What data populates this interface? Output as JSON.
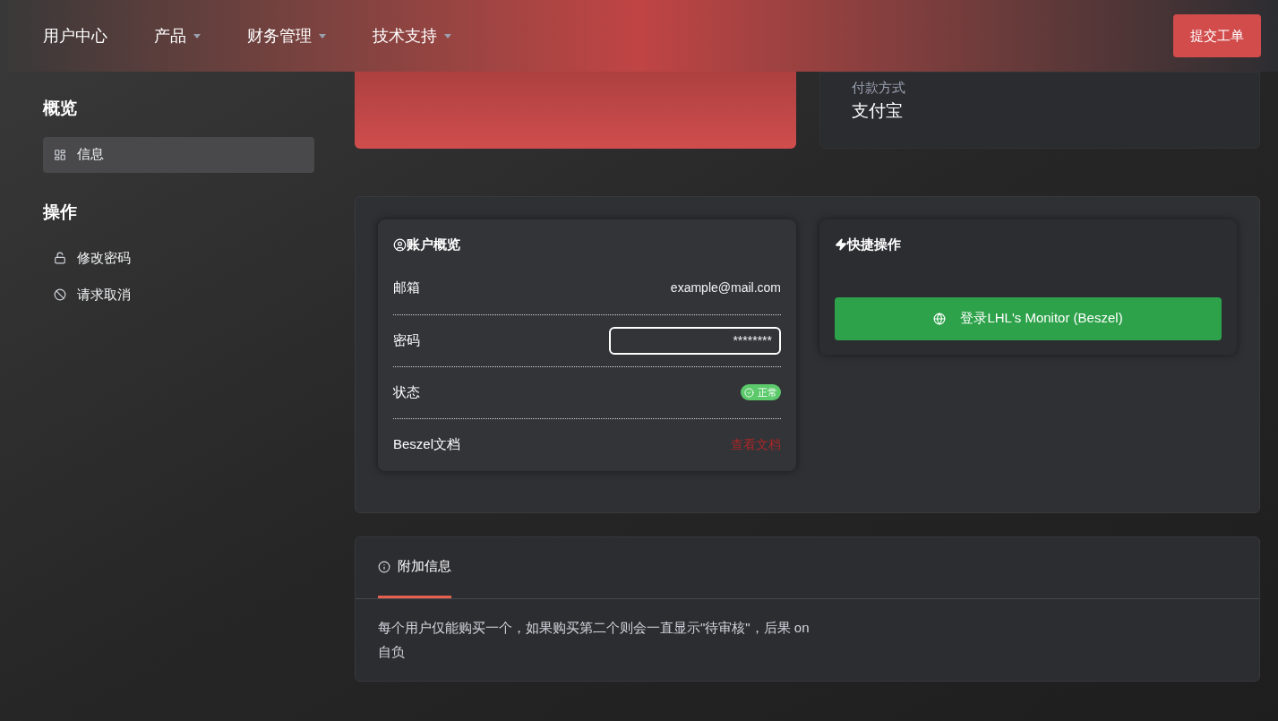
{
  "navbar": {
    "items": [
      {
        "label": "用户中心",
        "dropdown": false
      },
      {
        "label": "产品",
        "dropdown": true
      },
      {
        "label": "财务管理",
        "dropdown": true
      },
      {
        "label": "技术支持",
        "dropdown": true
      }
    ],
    "action": "提交工单"
  },
  "sidebar": {
    "sections": [
      {
        "title": "概览",
        "items": [
          {
            "label": "信息",
            "selected": true
          }
        ]
      },
      {
        "title": "操作",
        "items": [
          {
            "label": "修改密码",
            "selected": false
          },
          {
            "label": "请求取消",
            "selected": false
          }
        ]
      }
    ]
  },
  "summary": {
    "payment_label": "付款方式",
    "payment_value": "支付宝"
  },
  "account": {
    "title": "账户概览",
    "rows": [
      {
        "kind": "text",
        "label": "邮箱",
        "value": "example@mail.com"
      },
      {
        "kind": "field",
        "label": "密码",
        "value": "********"
      },
      {
        "kind": "badge",
        "label": "状态",
        "value": "正常"
      },
      {
        "kind": "link",
        "label": "Beszel文档",
        "value": "查看文档"
      }
    ]
  },
  "quick": {
    "title": "快捷操作",
    "button": "登录LHL's Monitor (Beszel)"
  },
  "extra": {
    "tabs": [
      {
        "label": "附加信息",
        "selected": true
      }
    ],
    "text": "每个用户仅能购买一个，如果购买第二个则会一直显示\"待审核\"，后果 on 自负"
  }
}
